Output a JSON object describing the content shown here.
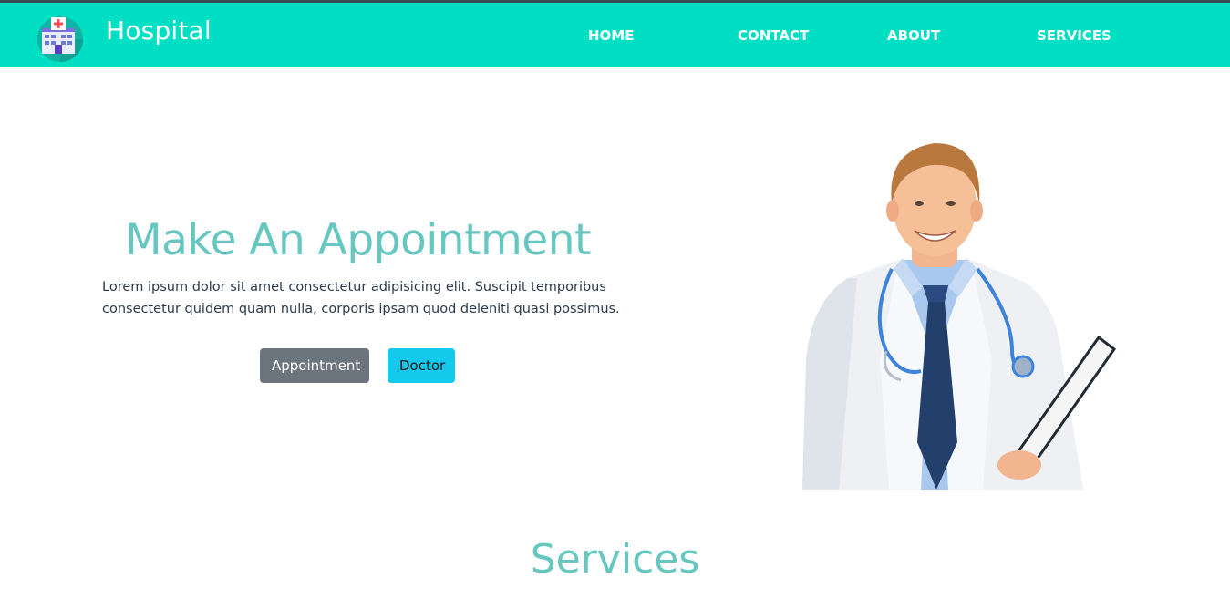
{
  "brand": {
    "name": "Hospital",
    "logo_icon": "hospital-building-icon"
  },
  "nav": {
    "items": [
      {
        "label": "HOME"
      },
      {
        "label": "CONTACT"
      },
      {
        "label": "ABOUT"
      },
      {
        "label": "SERVICES"
      }
    ]
  },
  "hero": {
    "title": "Make An Appointment",
    "text": "Lorem ipsum dolor sit amet consectetur adipisicing elit. Suscipit temporibus consectetur quidem quam nulla, corporis ipsam quod deleniti quasi possimus.",
    "buttons": {
      "appointment": "Appointment",
      "doctor": "Doctor"
    },
    "image_icon": "doctor-photo"
  },
  "services": {
    "title": "Services"
  },
  "colors": {
    "navbar": "#00dfc4",
    "accent_text": "#66c7c1",
    "button_secondary": "#6c757d",
    "button_info": "#13c9ec"
  }
}
